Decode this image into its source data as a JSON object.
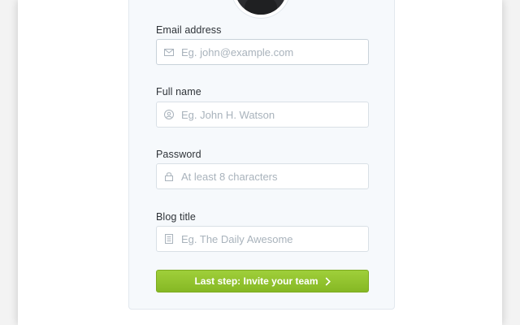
{
  "form": {
    "fields": [
      {
        "label": "Email address",
        "placeholder": "Eg. john@example.com",
        "value": "",
        "icon": "envelope-icon"
      },
      {
        "label": "Full name",
        "placeholder": "Eg. John H. Watson",
        "value": "",
        "icon": "user-icon"
      },
      {
        "label": "Password",
        "placeholder": "At least 8 characters",
        "value": "",
        "icon": "lock-icon"
      },
      {
        "label": "Blog title",
        "placeholder": "Eg. The Daily Awesome",
        "value": "",
        "icon": "document-icon"
      }
    ],
    "submit_label": "Last step: Invite your team",
    "submit_icon": "chevron-right-icon"
  },
  "colors": {
    "accent_green": "#8dc22c",
    "card_background": "#f6f9fc",
    "placeholder_text": "#a9b3bc"
  }
}
